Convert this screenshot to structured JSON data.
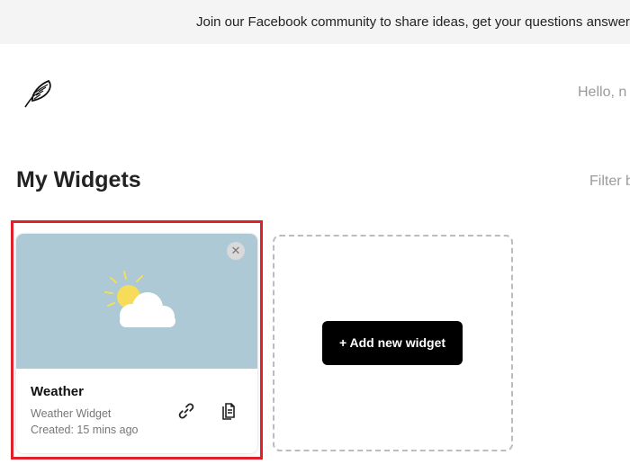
{
  "banner": {
    "text": "Join our Facebook community to share ideas, get your questions answered"
  },
  "header": {
    "logo_icon": "feather-icon",
    "greeting": "Hello, n"
  },
  "main": {
    "title": "My Widgets",
    "filter_label": "Filter b"
  },
  "widgets": [
    {
      "name": "Weather",
      "type": "Weather Widget",
      "created": "Created: 15 mins ago",
      "preview_icon": "sun-cloud-icon",
      "close_symbol": "✕"
    }
  ],
  "add_widget": {
    "label": "+ Add new widget"
  },
  "colors": {
    "preview_background": "#adc9d5",
    "highlight": "#e0212b",
    "sun": "#f7dc5a",
    "button_background": "#000000"
  }
}
